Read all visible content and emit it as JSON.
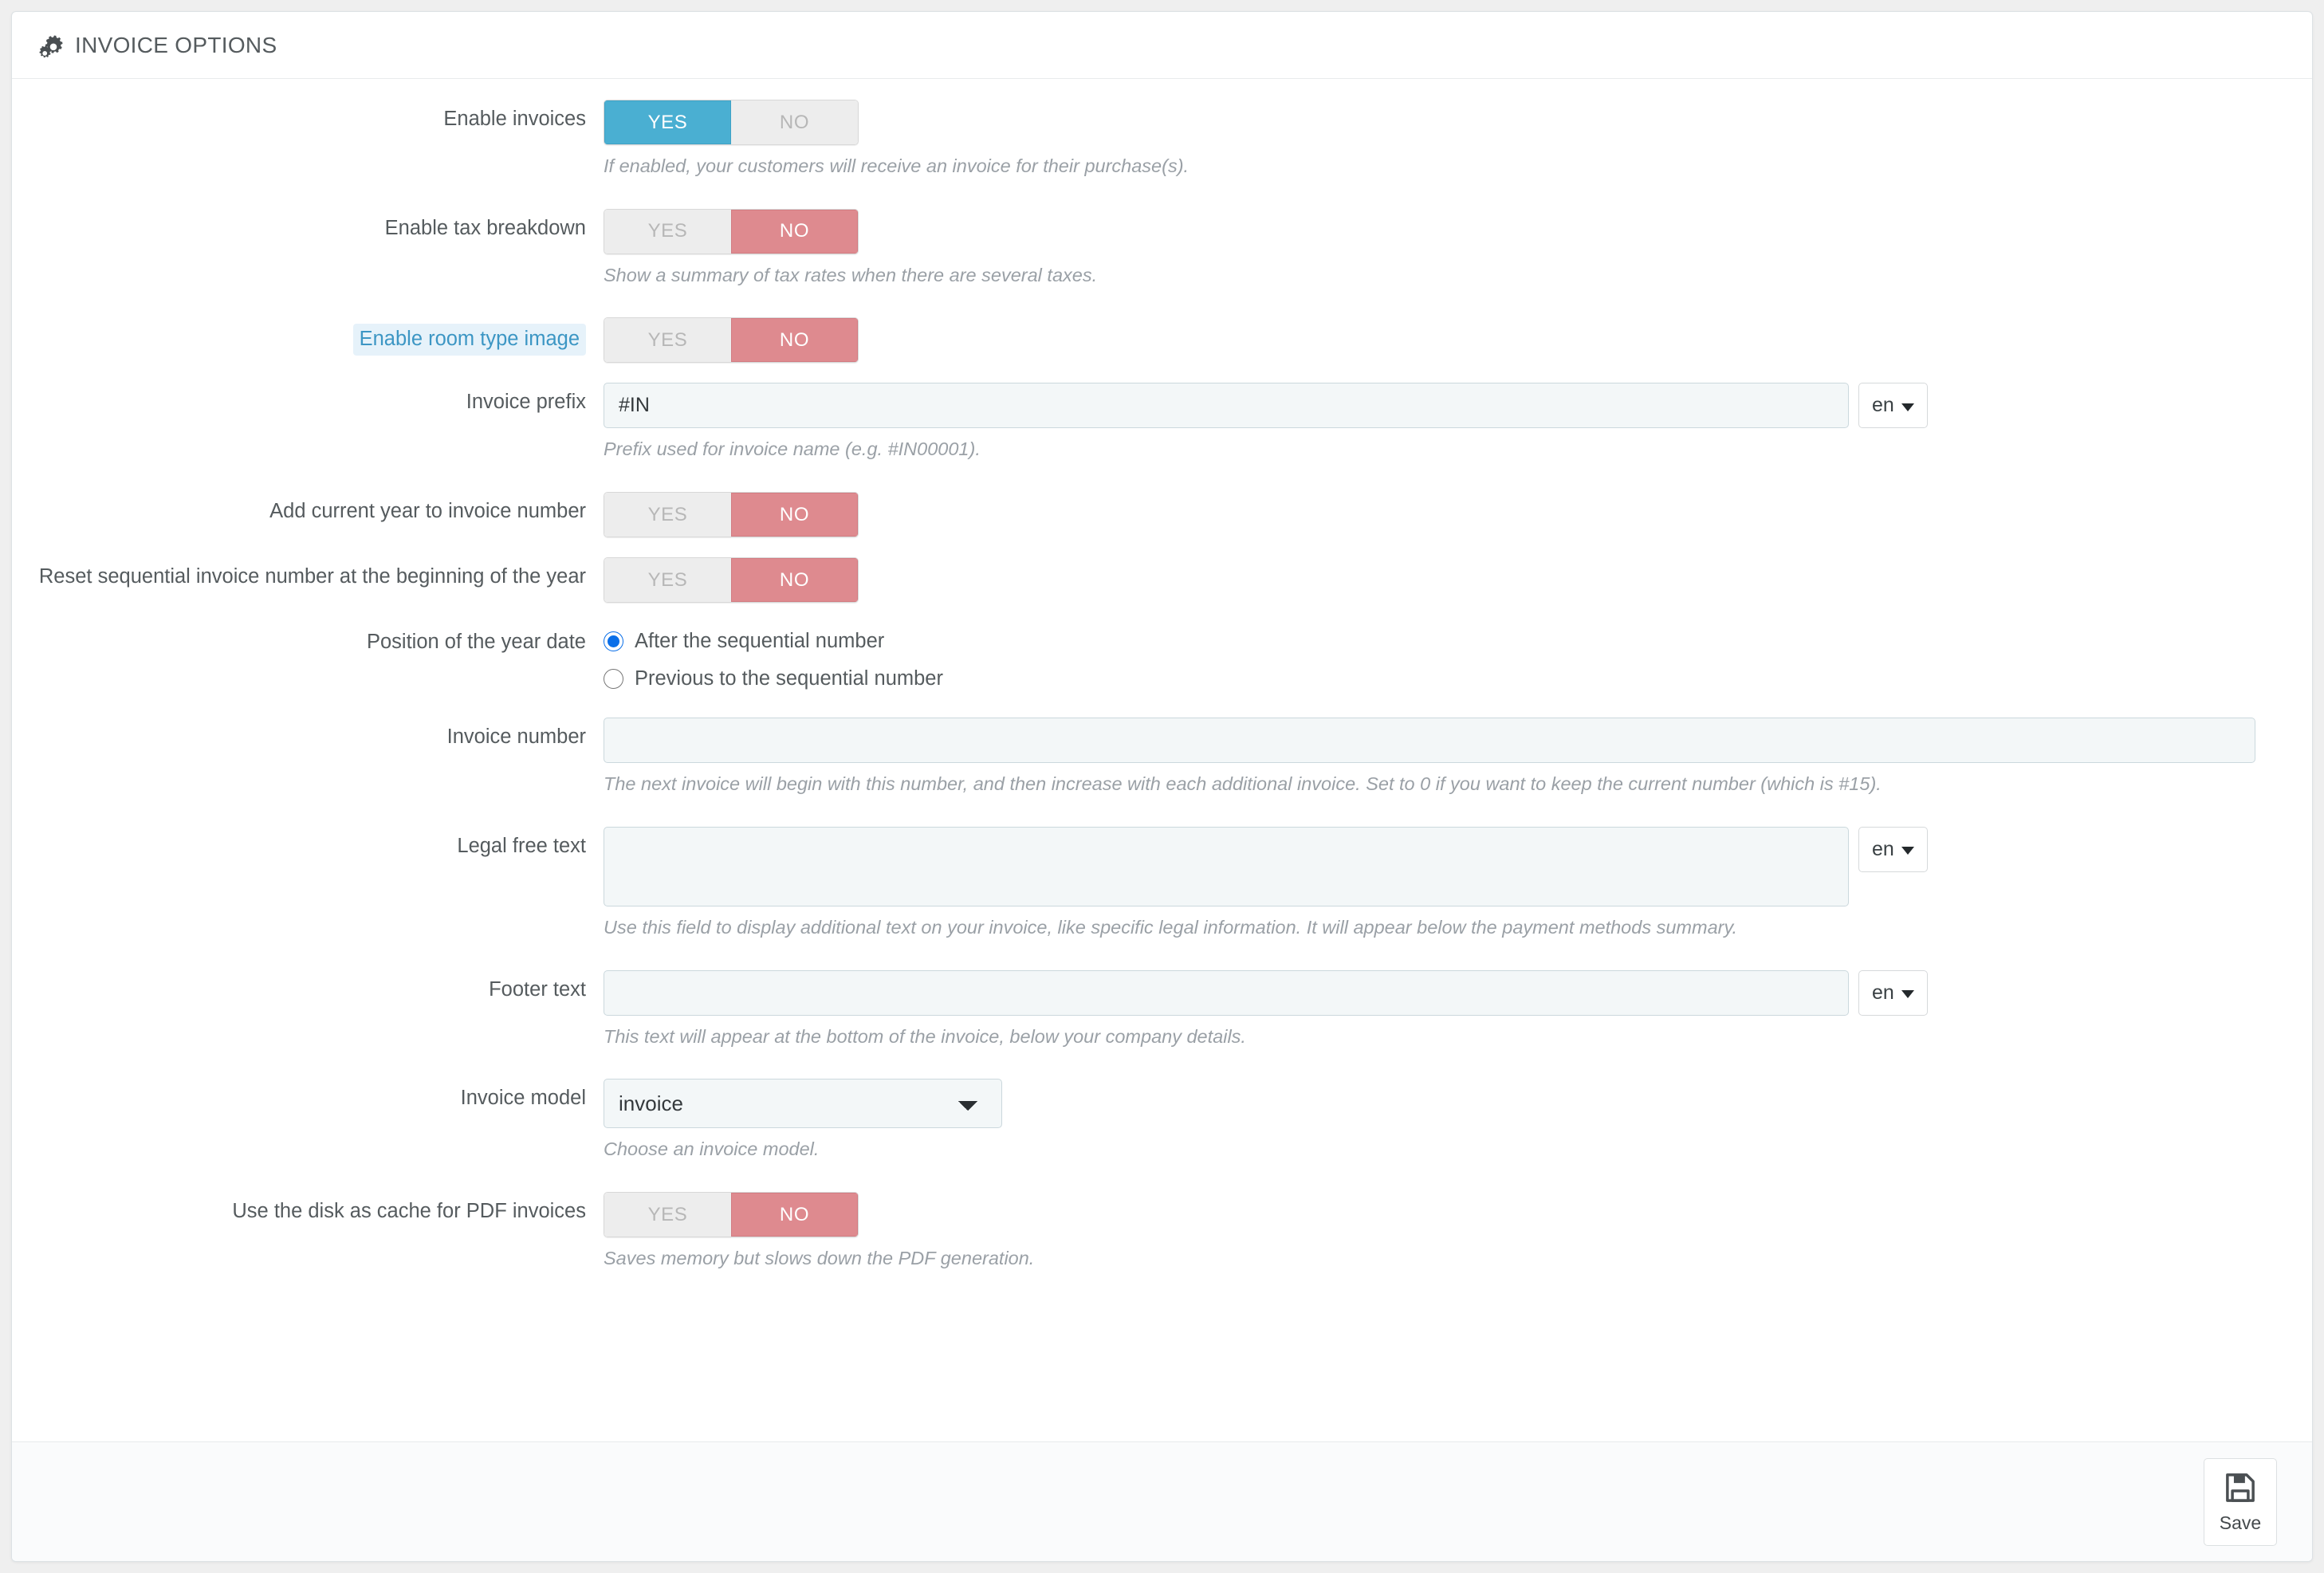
{
  "panel": {
    "title": "INVOICE OPTIONS",
    "header_icon": "cogs-icon"
  },
  "switch_labels": {
    "yes": "YES",
    "no": "NO"
  },
  "fields": {
    "enable_invoices": {
      "label": "Enable invoices",
      "value": "YES",
      "help": "If enabled, your customers will receive an invoice for their purchase(s)."
    },
    "enable_tax_breakdown": {
      "label": "Enable tax breakdown",
      "value": "NO",
      "help": "Show a summary of tax rates when there are several taxes."
    },
    "enable_room_type_image": {
      "label": "Enable room type image",
      "value": "NO",
      "highlight_bg": "#E6F2FA",
      "highlight_fg": "#3C96C4"
    },
    "invoice_prefix": {
      "label": "Invoice prefix",
      "value": "#IN",
      "lang": "en",
      "help": "Prefix used for invoice name (e.g. #IN00001)."
    },
    "add_current_year": {
      "label": "Add current year to invoice number",
      "value": "NO"
    },
    "reset_sequential": {
      "label": "Reset sequential invoice number at the beginning of the year",
      "value": "NO"
    },
    "year_position": {
      "label": "Position of the year date",
      "options": [
        {
          "label": "After the sequential number",
          "selected": true
        },
        {
          "label": "Previous to the sequential number",
          "selected": false
        }
      ]
    },
    "invoice_number": {
      "label": "Invoice number",
      "value": "",
      "placeholder": "",
      "help": "The next invoice will begin with this number, and then increase with each additional invoice. Set to 0 if you want to keep the current number (which is #15)."
    },
    "legal_free_text": {
      "label": "Legal free text",
      "value": "",
      "placeholder": "",
      "lang": "en",
      "help": "Use this field to display additional text on your invoice, like specific legal information. It will appear below the payment methods summary."
    },
    "footer_text": {
      "label": "Footer text",
      "value": "",
      "placeholder": "",
      "lang": "en",
      "help": "This text will appear at the bottom of the invoice, below your company details."
    },
    "invoice_model": {
      "label": "Invoice model",
      "value": "invoice",
      "options": [
        "invoice"
      ],
      "help": "Choose an invoice model."
    },
    "disk_cache": {
      "label": "Use the disk as cache for PDF invoices",
      "value": "NO",
      "help": "Saves memory but slows down the PDF generation."
    }
  },
  "footer": {
    "save_label": "Save",
    "save_icon": "floppy-disk-icon"
  },
  "colors": {
    "accent_on": "#4AAFD2",
    "accent_off": "#DE8A8F",
    "highlight": "#E6F2FA",
    "page_bg": "#EFEFEF"
  }
}
